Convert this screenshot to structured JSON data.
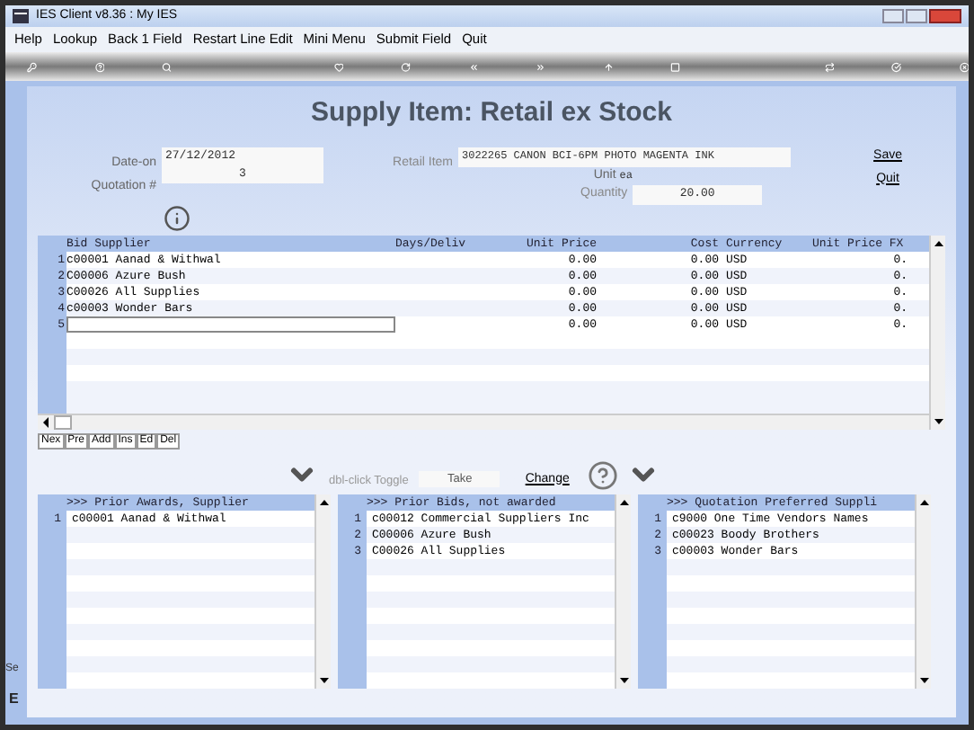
{
  "window": {
    "title": "IES Client v8.36 : My IES"
  },
  "menu": [
    "Help",
    "Lookup",
    "Back 1 Field",
    "Restart Line Edit",
    "Mini Menu",
    "Submit Field",
    "Quit"
  ],
  "page_title": "Supply Item: Retail ex Stock",
  "form": {
    "date_on": {
      "label": "Date-on",
      "value": "27/12/2012"
    },
    "quotation": {
      "label": "Quotation #",
      "value": "3"
    },
    "retail_item": {
      "label": "Retail Item",
      "value": "3022265 CANON BCI-6PM PHOTO MAGENTA INK"
    },
    "unit": {
      "label": "Unit",
      "value": "ea"
    },
    "quantity": {
      "label": "Quantity",
      "value": "20.00"
    }
  },
  "links": [
    "Save",
    "Quit"
  ],
  "grid": {
    "columns": [
      "Bid Supplier",
      "Days/Deliv",
      "Unit Price",
      "Cost",
      "Currency",
      "Unit Price FX"
    ],
    "rows": [
      {
        "number": "1",
        "supplier": "c00001 Aanad & Withwal",
        "unit_price": "0.00",
        "cost": "0.00",
        "currency": "USD",
        "fx": "0.",
        "editing": false
      },
      {
        "number": "2",
        "supplier": "C00006 Azure Bush",
        "unit_price": "0.00",
        "cost": "0.00",
        "currency": "USD",
        "fx": "0.",
        "editing": false
      },
      {
        "number": "3",
        "supplier": "C00026 All Supplies",
        "unit_price": "0.00",
        "cost": "0.00",
        "currency": "USD",
        "fx": "0.",
        "editing": false
      },
      {
        "number": "4",
        "supplier": "c00003 Wonder Bars",
        "unit_price": "0.00",
        "cost": "0.00",
        "currency": "USD",
        "fx": "0.",
        "editing": false
      },
      {
        "number": "5",
        "unit_price": "0.00",
        "cost": "0.00",
        "currency": "USD",
        "fx": "0.",
        "editing": true
      }
    ]
  },
  "row_buttons": [
    "Nex",
    "Pre",
    "Add",
    "Ins",
    "Ed",
    "Del"
  ],
  "toggle_hint": "dbl-click Toggle",
  "take": "Take",
  "change": "Change",
  "lists": [
    {
      "header": ">>> Prior Awards, Supplier",
      "items": [
        {
          "number": "1",
          "text": "c00001 Aanad & Withwal"
        }
      ]
    },
    {
      "header": ">>> Prior Bids, not awarded",
      "items": [
        {
          "number": "1",
          "text": "c00012 Commercial Suppliers Inc"
        },
        {
          "number": "2",
          "text": "C00006 Azure Bush"
        },
        {
          "number": "3",
          "text": "C00026 All Supplies"
        }
      ]
    },
    {
      "header": ">>> Quotation Preferred Suppli",
      "items": [
        {
          "number": "1",
          "text": "c9000 One Time Vendors Names"
        },
        {
          "number": "2",
          "text": "c00023 Boody Brothers"
        },
        {
          "number": "3",
          "text": "c00003 Wonder Bars"
        }
      ]
    }
  ],
  "side_labels": [
    "Se",
    "E"
  ]
}
